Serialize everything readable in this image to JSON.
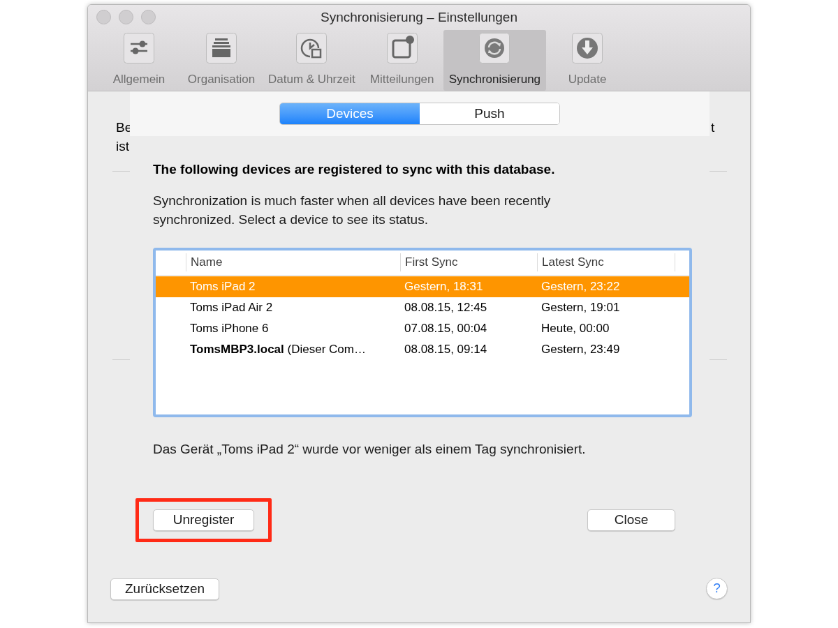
{
  "window": {
    "title": "Synchronisierung – Einstellungen"
  },
  "toolbar": [
    {
      "label": "Allgemein",
      "kind": "sliders",
      "selected": false
    },
    {
      "label": "Organisation",
      "kind": "stack",
      "selected": false
    },
    {
      "label": "Datum & Uhrzeit",
      "kind": "clock",
      "selected": false
    },
    {
      "label": "Mitteilungen",
      "kind": "notice",
      "selected": false
    },
    {
      "label": "Synchronisierung",
      "kind": "sync",
      "selected": true
    },
    {
      "label": "Update",
      "kind": "download",
      "selected": false
    }
  ],
  "background": {
    "left_lines": [
      "Be",
      "ist"
    ],
    "right_lines": [
      "t"
    ]
  },
  "sheet": {
    "segments": [
      {
        "label": "Devices",
        "selected": true
      },
      {
        "label": "Push",
        "selected": false
      }
    ],
    "heading": "The following devices are registered to sync with this database.",
    "description": "Synchronization is much faster when all devices have been recently synchronized. Select a device to see its status.",
    "table": {
      "columns": [
        "Name",
        "First Sync",
        "Latest Sync"
      ],
      "rows": [
        {
          "cells": [
            "Toms iPad 2",
            "Gestern, 18:31",
            "Gestern, 23:22"
          ],
          "selected": true
        },
        {
          "cells": [
            "Toms iPad Air 2",
            "08.08.15, 12:45",
            "Gestern, 19:01"
          ],
          "selected": false
        },
        {
          "cells": [
            "Toms iPhone 6",
            "07.08.15, 00:04",
            "Heute, 00:00"
          ],
          "selected": false
        },
        {
          "cells": [
            "**TomsMBP3.local** (Dieser Com…",
            "08.08.15, 09:14",
            "Gestern, 23:49"
          ],
          "selected": false
        }
      ]
    },
    "status": "Das Gerät „Toms iPad 2“ wurde vor weniger als einem Tag synchronisiert.",
    "buttons": [
      {
        "label": "Unregister",
        "highlighted": true
      },
      {
        "label": "Close",
        "highlighted": false
      }
    ]
  },
  "footer": {
    "reset_button": "Zurücksetzen",
    "help_button": "?"
  }
}
